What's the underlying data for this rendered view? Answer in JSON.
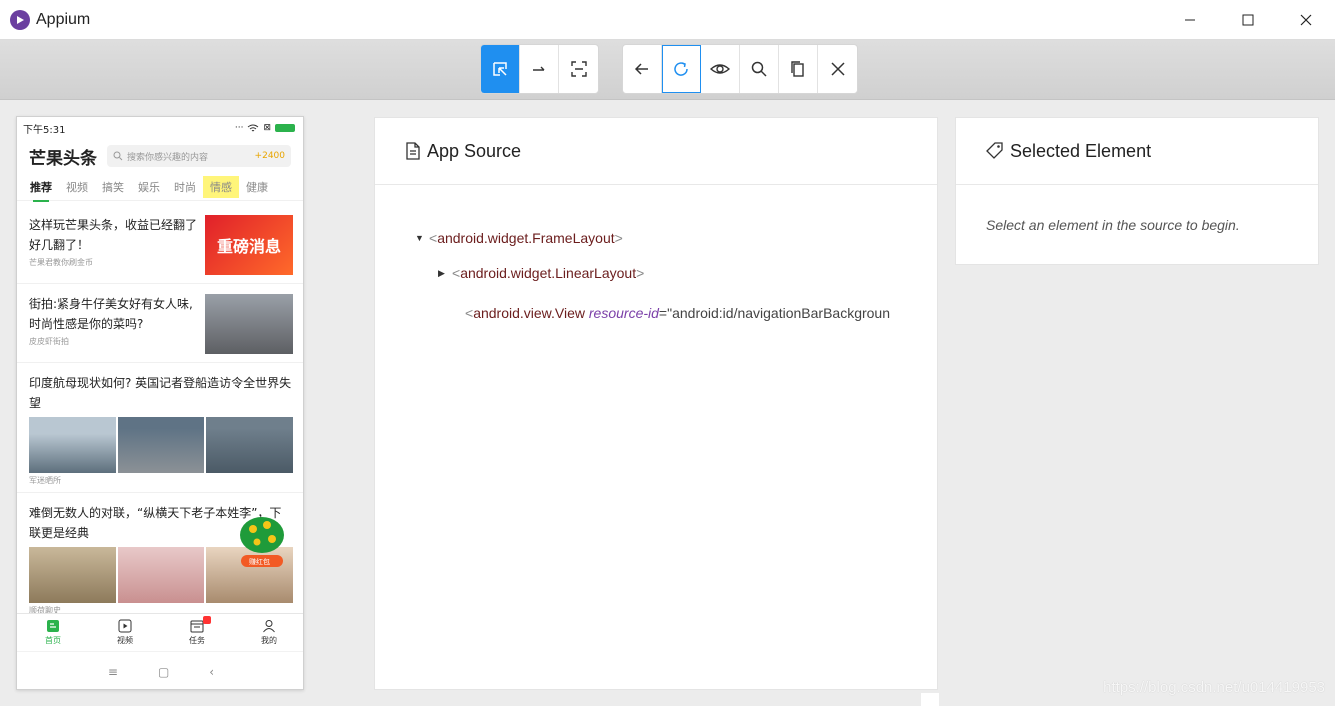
{
  "window": {
    "title": "Appium"
  },
  "phone": {
    "status_time": "下午5:31",
    "brand": "芒果头条",
    "search_placeholder": "搜索你感兴趣的内容",
    "coins": "+2400",
    "tabs": [
      "推荐",
      "视频",
      "搞笑",
      "娱乐",
      "时尚",
      "情感",
      "健康"
    ],
    "news": [
      {
        "title": "这样玩芒果头条，收益已经翻了好几翻了！",
        "source": "芒果君教你刷金币",
        "thumb_text": "重磅消息"
      },
      {
        "title": "街拍:紧身牛仔美女好有女人味,时尚性感是你的菜吗?",
        "source": "皮皮虾街拍"
      },
      {
        "title": "印度航母现状如何? 英国记者登船造访令全世界失望",
        "source": "军迷晒所"
      },
      {
        "title": "难倒无数人的对联，“纵横天下老子本姓李”，下联更是经典",
        "source": "顺荷聊史"
      }
    ],
    "badge_text": "赚红包",
    "bottom_nav": [
      "首页",
      "视频",
      "任务",
      "我的"
    ]
  },
  "source_panel": {
    "title": "App Source",
    "nodes": {
      "root": "android.widget.FrameLayout",
      "child1": "android.widget.LinearLayout",
      "child2_tag": "android.view.View",
      "child2_attr": "resource-id",
      "child2_val": "\"android:id/navigationBarBackgroun"
    }
  },
  "selected_panel": {
    "title": "Selected Element",
    "hint": "Select an element in the source to begin."
  },
  "watermark": "https://blog.csdn.net/u014419953",
  "colors": {
    "accent": "#1f8ff0",
    "brand_green": "#2bb24c",
    "tag": "#6b1d1d",
    "attr": "#7b3fa8"
  }
}
